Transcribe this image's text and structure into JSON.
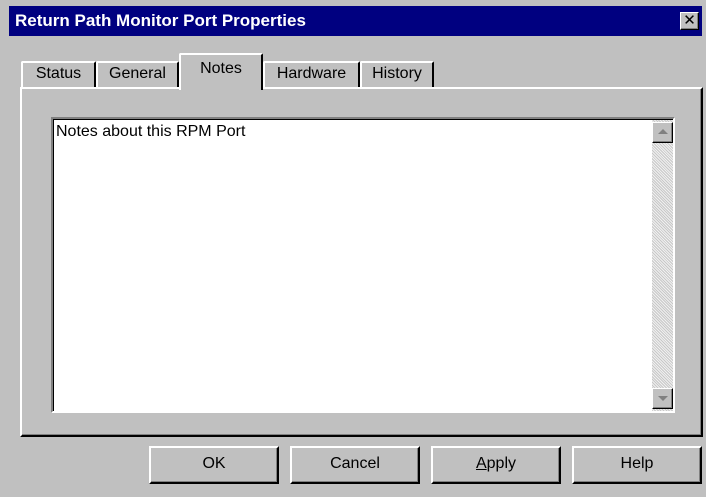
{
  "window": {
    "title": "Return Path Monitor Port Properties",
    "close_glyph": "✕"
  },
  "tabs": [
    {
      "label": "Status",
      "active": false
    },
    {
      "label": "General",
      "active": false
    },
    {
      "label": "Notes",
      "active": true
    },
    {
      "label": "Hardware",
      "active": false
    },
    {
      "label": "History",
      "active": false
    }
  ],
  "notes": {
    "value": "Notes about this RPM Port"
  },
  "buttons": {
    "ok": "OK",
    "cancel": "Cancel",
    "apply_mnemonic": "A",
    "apply_rest": "pply",
    "help": "Help"
  },
  "colors": {
    "titlebar": "#000080",
    "face": "#c0c0c0"
  },
  "icons": {
    "close": "close-icon",
    "scroll_up": "scroll-up-arrow-icon",
    "scroll_down": "scroll-down-arrow-icon"
  }
}
